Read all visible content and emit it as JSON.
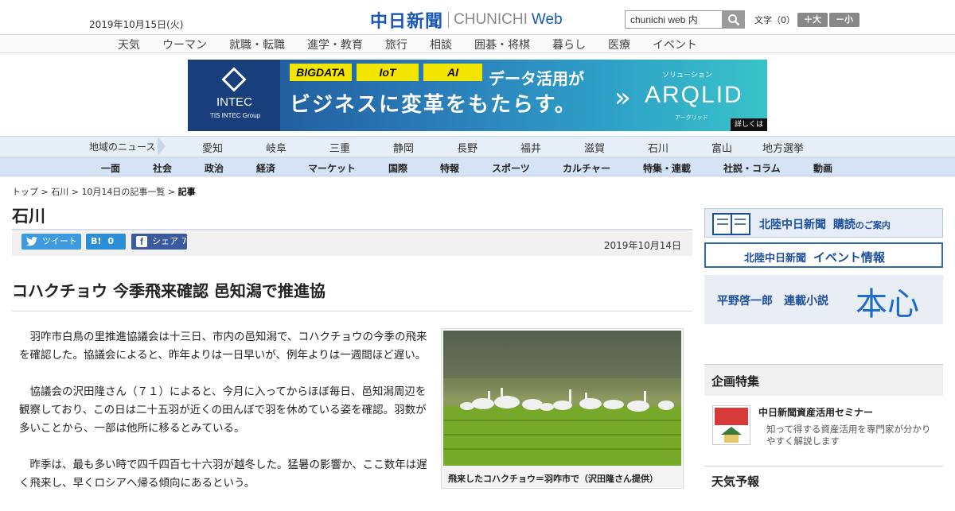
{
  "header": {
    "date": "2019年10月15日(火)",
    "logo_jp": "中日新聞",
    "logo_en": "CHUNICHI",
    "logo_web": "Web",
    "search_value": "chunichi web 内",
    "fontsize_label": "文字（0）",
    "font_larger": "＋大",
    "font_smaller": "－小"
  },
  "genre_nav": [
    "天気",
    "ウーマン",
    "就職・転職",
    "進学・教育",
    "旅行",
    "相談",
    "囲碁・将棋",
    "暮らし",
    "医療",
    "イベント"
  ],
  "ad": {
    "brand": "INTEC",
    "brand_sub": "TIS INTEC Group",
    "tags": [
      "BIGDATA",
      "IoT",
      "AI"
    ],
    "line1": "データ活用が",
    "line2": "ビジネスに変革をもたらす。",
    "solution": "ソリューション",
    "product": "ARQLID",
    "product_kana": "アークリッド",
    "more": "詳しくは"
  },
  "region_nav": {
    "label": "地域のニュース",
    "items": [
      "愛知",
      "岐阜",
      "三重",
      "静岡",
      "長野",
      "福井",
      "滋賀",
      "石川",
      "富山",
      "地方選挙"
    ]
  },
  "section_nav": [
    "一面",
    "社会",
    "政治",
    "経済",
    "マーケット",
    "国際",
    "特報",
    "スポーツ",
    "カルチャー",
    "特集・連載",
    "社説・コラム",
    "動画"
  ],
  "breadcrumb": {
    "items": [
      "トップ",
      "石川",
      "10月14日の記事一覧"
    ],
    "current": "記事",
    "sep": " > "
  },
  "page_title": "石川",
  "share": {
    "tweet": "ツイート",
    "hatena_count": "0",
    "facebook": "シェア",
    "facebook_count": "7",
    "date": "2019年10月14日"
  },
  "article": {
    "headline": "コハクチョウ 今季飛来確認 邑知潟で推進協",
    "paragraphs": [
      "羽咋市白鳥の里推進協議会は十三日、市内の邑知潟で、コハクチョウの今季の飛来を確認した。協議会によると、昨年よりは一日早いが、例年よりは一週間ほど遅い。",
      "協議会の沢田隆さん（７１）によると、今月に入ってからほぼ毎日、邑知潟周辺を観察しており、この日は二十五羽が近くの田んぼで羽を休めている姿を確認。羽数が多いことから、一部は他所に移るとみている。",
      "昨季は、最も多い時で四千四百七十六羽が越冬した。猛暑の影響か、ここ数年は遅く飛来し、早くロシアへ帰る傾向にあるという。"
    ],
    "photo_caption": "飛来したコハクチョウ＝羽咋市で（沢田隆さん提供）"
  },
  "sidebar": {
    "subscribe_main": "北陸中日新聞",
    "subscribe_bold": "購読",
    "subscribe_tail": "のご案内",
    "event_main": "北陸中日新聞",
    "event_tail": "イベント情報",
    "novel_author": "平野啓一郎　連載小説",
    "novel_title": "本心",
    "feature_heading": "企画特集",
    "feature_title": "中日新聞資産活用セミナー",
    "feature_desc": "知って得する資産活用を専門家が分かりやすく解説します",
    "feature_icon_text": "セミナー資産活用",
    "weather_heading": "天気予報"
  }
}
